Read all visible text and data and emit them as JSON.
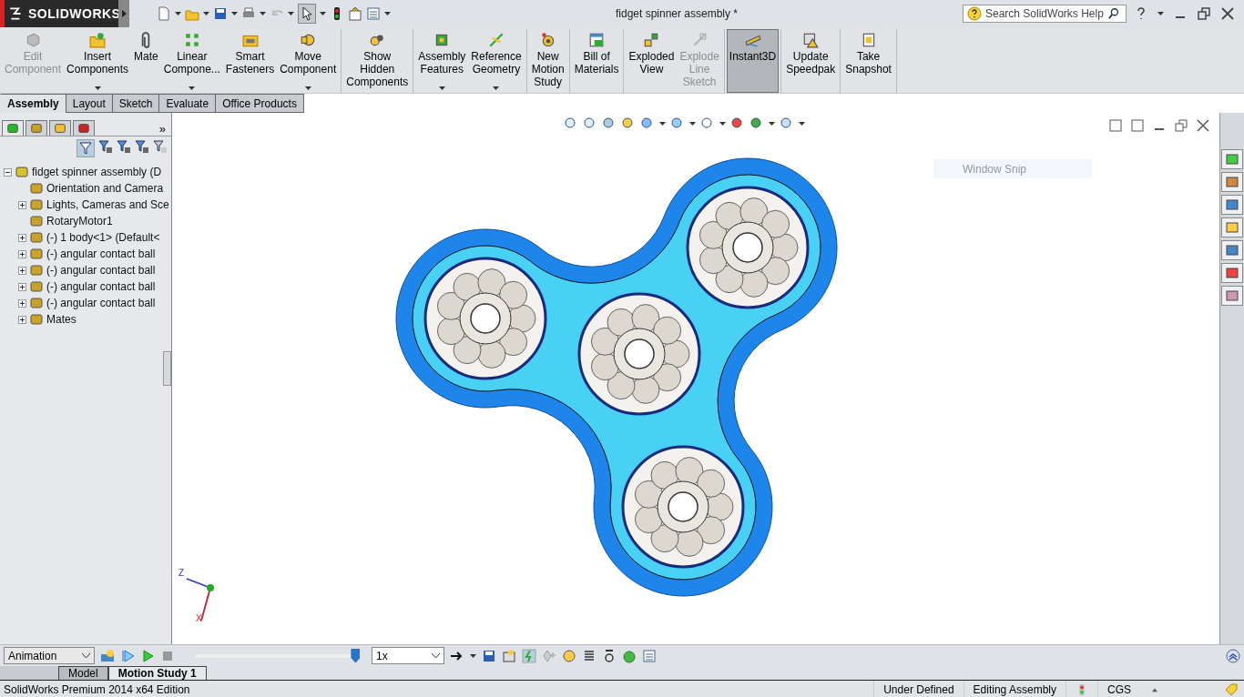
{
  "window": {
    "title": "fidget spinner assembly *"
  },
  "brand": {
    "name": "SOLIDWORKS"
  },
  "quick_access": {
    "undo_disabled": true,
    "select_pressed": true
  },
  "help_search": {
    "placeholder": "Search SolidWorks Help"
  },
  "command_groups": [
    [
      {
        "lines": [
          "Edit",
          "Component"
        ],
        "disabled": true,
        "dropdown": false,
        "selected": false
      },
      {
        "lines": [
          "Insert",
          "Components"
        ],
        "disabled": false,
        "dropdown": true,
        "selected": false
      },
      {
        "lines": [
          "Mate"
        ],
        "disabled": false,
        "dropdown": false,
        "selected": false
      },
      {
        "lines": [
          "Linear",
          "Compone..."
        ],
        "disabled": false,
        "dropdown": true,
        "selected": false
      },
      {
        "lines": [
          "Smart",
          "Fasteners"
        ],
        "disabled": false,
        "dropdown": false,
        "selected": false
      },
      {
        "lines": [
          "Move",
          "Component"
        ],
        "disabled": false,
        "dropdown": true,
        "selected": false
      }
    ],
    [
      {
        "lines": [
          "Show",
          "Hidden",
          "Components"
        ],
        "disabled": false,
        "dropdown": false,
        "selected": false
      }
    ],
    [
      {
        "lines": [
          "Assembly",
          "Features"
        ],
        "disabled": false,
        "dropdown": true,
        "selected": false
      },
      {
        "lines": [
          "Reference",
          "Geometry"
        ],
        "disabled": false,
        "dropdown": true,
        "selected": false
      }
    ],
    [
      {
        "lines": [
          "New",
          "Motion",
          "Study"
        ],
        "disabled": false,
        "dropdown": false,
        "selected": false
      }
    ],
    [
      {
        "lines": [
          "Bill of",
          "Materials"
        ],
        "disabled": false,
        "dropdown": false,
        "selected": false
      }
    ],
    [
      {
        "lines": [
          "Exploded",
          "View"
        ],
        "disabled": false,
        "dropdown": false,
        "selected": false
      },
      {
        "lines": [
          "Explode",
          "Line",
          "Sketch"
        ],
        "disabled": true,
        "dropdown": false,
        "selected": false
      }
    ],
    [
      {
        "lines": [
          "Instant3D"
        ],
        "disabled": false,
        "dropdown": false,
        "selected": true
      }
    ],
    [
      {
        "lines": [
          "Update",
          "Speedpak"
        ],
        "disabled": false,
        "dropdown": false,
        "selected": false
      }
    ],
    [
      {
        "lines": [
          "Take",
          "Snapshot"
        ],
        "disabled": false,
        "dropdown": false,
        "selected": false
      }
    ]
  ],
  "command_tabs": [
    {
      "label": "Assembly",
      "selected": true
    },
    {
      "label": "Layout",
      "selected": false
    },
    {
      "label": "Sketch",
      "selected": false
    },
    {
      "label": "Evaluate",
      "selected": false
    },
    {
      "label": "Office Products",
      "selected": false
    }
  ],
  "panel_tabs": {
    "more": "»",
    "tabs": [
      {
        "selected": true
      },
      {
        "selected": false
      },
      {
        "selected": false
      },
      {
        "selected": false
      }
    ]
  },
  "feature_tree": {
    "label": "fidget spinner assembly  (D",
    "expanded": true,
    "children": [
      {
        "label": "Orientation and Camera"
      },
      {
        "label": "Lights, Cameras and Sce",
        "expanded": false
      },
      {
        "label": "RotaryMotor1"
      },
      {
        "label": "(-) 1 body<1> (Default<",
        "expanded": false
      },
      {
        "label": "(-) angular contact ball",
        "expanded": false
      },
      {
        "label": "(-) angular contact ball",
        "expanded": false
      },
      {
        "label": "(-) angular contact ball",
        "expanded": false
      },
      {
        "label": "(-) angular contact ball",
        "expanded": false
      },
      {
        "label": "Mates",
        "expanded": false
      }
    ]
  },
  "overlay_label": "Window Snip",
  "triad": {
    "z": "Z",
    "x": "X"
  },
  "motion": {
    "study_type": "Animation",
    "level": 0.98,
    "speed": "1x",
    "tabs": [
      {
        "label": "Model",
        "selected": false
      },
      {
        "label": "Motion Study 1",
        "selected": true
      }
    ]
  },
  "status_bar": {
    "edition": "SolidWorks Premium 2014 x64 Edition",
    "fields": [
      "Under Defined",
      "Editing Assembly",
      "CGS"
    ]
  }
}
